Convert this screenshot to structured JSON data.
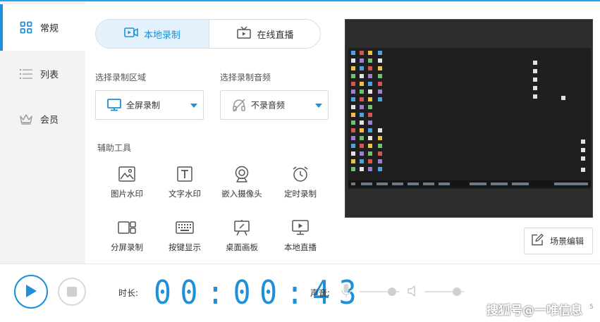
{
  "colors": {
    "accent": "#1e8fd8",
    "sidebar_bg": "#f3f3f3",
    "toggle_active_bg": "#e3f2fc",
    "preview_bg": "#2f2f2f"
  },
  "sidebar": {
    "items": [
      {
        "label": "常规",
        "icon": "grid-icon",
        "active": true
      },
      {
        "label": "列表",
        "icon": "list-icon",
        "active": false
      },
      {
        "label": "会员",
        "icon": "crown-icon",
        "active": false
      }
    ]
  },
  "mode": {
    "local_label": "本地录制",
    "live_label": "在线直播"
  },
  "record_area": {
    "label": "选择录制区域",
    "value": "全屏录制"
  },
  "record_audio": {
    "label": "选择录制音频",
    "value": "不录音频"
  },
  "tools": {
    "label": "辅助工具",
    "items": [
      {
        "label": "图片水印",
        "icon": "image-icon"
      },
      {
        "label": "文字水印",
        "icon": "text-icon"
      },
      {
        "label": "嵌入摄像头",
        "icon": "webcam-icon"
      },
      {
        "label": "定时录制",
        "icon": "alarm-clock-icon"
      },
      {
        "label": "分屏录制",
        "icon": "split-screen-icon"
      },
      {
        "label": "按键显示",
        "icon": "keyboard-icon"
      },
      {
        "label": "桌面画板",
        "icon": "easel-icon"
      },
      {
        "label": "本地直播",
        "icon": "monitor-play-icon"
      }
    ]
  },
  "scene_edit_label": "场景编辑",
  "bottom": {
    "duration_label": "时长:",
    "timer": "00:00:43",
    "sound_label": "声音:",
    "mic_level": 0.82,
    "speaker_level": 0.82
  },
  "watermark": "搜狐号@一唯信息",
  "page_number": "5"
}
